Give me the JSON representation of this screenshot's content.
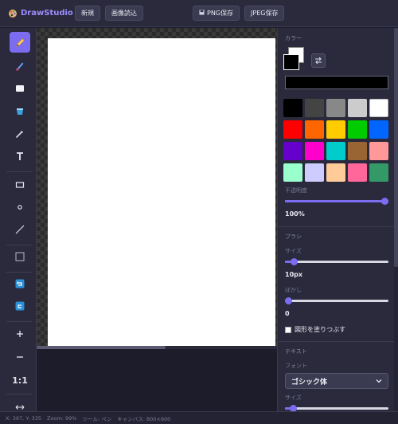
{
  "app": {
    "name": "DrawStudio",
    "logo_icon": "palette-icon"
  },
  "header": {
    "new_label": "新規",
    "open_label": "画像読込",
    "save_png_label": "PNG保存",
    "save_jpeg_label": "JPEG保存"
  },
  "toolbar": {
    "zoom_reset_label": "1:1",
    "active_tool": "pen",
    "colors": {
      "active_bg": "#7b6cf0"
    }
  },
  "panel": {
    "color": {
      "title": "カラー",
      "foreground": "#000000",
      "background": "#ffffff",
      "hex_value": "",
      "palette": [
        "#000000",
        "#444444",
        "#888888",
        "#cccccc",
        "#ffffff",
        "#ff0000",
        "#ff6600",
        "#ffcc00",
        "#00cc00",
        "#0066ff",
        "#6600cc",
        "#ff00cc",
        "#00cccc",
        "#996633",
        "#ff9999",
        "#99ffcc",
        "#ccccff",
        "#ffcc99",
        "#ff6699",
        "#339966"
      ],
      "opacity_label": "不透明度",
      "opacity_value": "100%",
      "opacity_fraction": 1.0
    },
    "brush": {
      "title": "ブラシ",
      "size_label": "サイズ",
      "size_value": "10px",
      "size_fraction": 0.06,
      "blur_label": "ぼかし",
      "blur_value": "0",
      "blur_fraction": 0.0,
      "fill_shape_label": "図形を塗りつぶす",
      "fill_shape_checked": false
    },
    "text": {
      "title": "テキスト",
      "font_label": "フォント",
      "font_value": "ゴシック体",
      "size_label": "サイズ"
    }
  },
  "status": {
    "coords": "X: 397, Y: 335",
    "zoom": "Zoom: 99%",
    "tool": "ツール: ペン",
    "canvas": "キャンバス: 800×600"
  }
}
